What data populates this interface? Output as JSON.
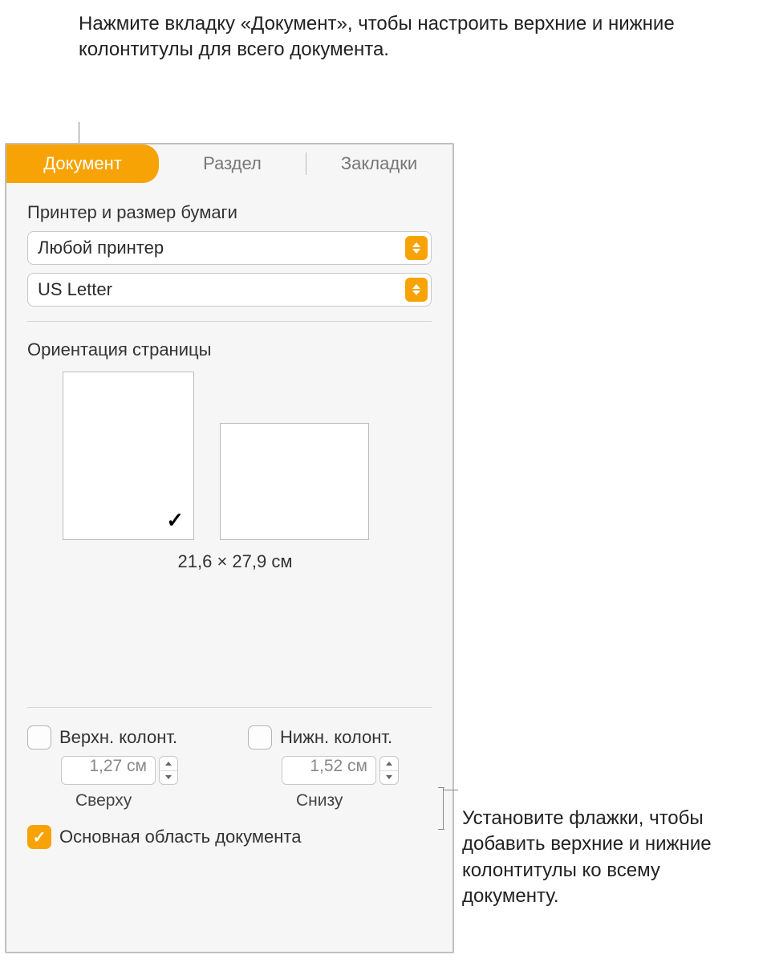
{
  "callouts": {
    "top": "Нажмите вкладку «Документ», чтобы настроить верхние и нижние колонтитулы для всего документа.",
    "right": "Установите флажки, чтобы добавить верхние и нижние колонтитулы ко всему документу."
  },
  "tabs": {
    "document": "Документ",
    "section": "Раздел",
    "bookmarks": "Закладки"
  },
  "printer": {
    "title": "Принтер и размер бумаги",
    "printer_value": "Любой принтер",
    "paper_value": "US Letter"
  },
  "orientation": {
    "title": "Ориентация страницы",
    "dimensions": "21,6 × 27,9 см",
    "check": "✓"
  },
  "headers": {
    "header_label": "Верхн. колонт.",
    "footer_label": "Нижн. колонт.",
    "header_value": "1,27 см",
    "footer_value": "1,52 см",
    "top_sublabel": "Сверху",
    "bottom_sublabel": "Снизу",
    "body_label": "Основная область документа",
    "body_check": "✓"
  }
}
